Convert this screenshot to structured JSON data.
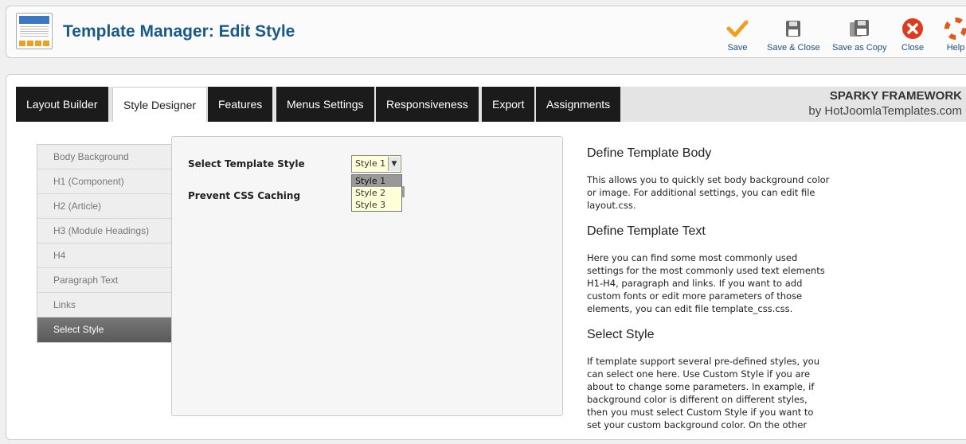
{
  "header": {
    "title": "Template Manager: Edit Style",
    "toolbar": [
      {
        "label": "Save",
        "icon": "checkmark-icon"
      },
      {
        "label": "Save & Close",
        "icon": "floppy-icon"
      },
      {
        "label": "Save as Copy",
        "icon": "floppy-copy-icon"
      },
      {
        "label": "Close",
        "icon": "close-circle-icon"
      },
      {
        "label": "Help",
        "icon": "lifebuoy-icon"
      }
    ]
  },
  "tabs": [
    "Layout Builder",
    "Style Designer",
    "Features",
    "Menus Settings",
    "Responsiveness",
    "Export",
    "Assignments"
  ],
  "active_tab": "Style Designer",
  "brand": {
    "title": "SPARKY FRAMEWORK",
    "subtitle": "by HotJoomlaTemplates.com"
  },
  "left_menu": [
    "Body Background",
    "H1 (Component)",
    "H2 (Article)",
    "H3 (Module Headings)",
    "H4",
    "Paragraph Text",
    "Links",
    "Select Style"
  ],
  "left_menu_active": "Select Style",
  "form": {
    "select_style_label": "Select Template Style",
    "prevent_caching_label": "Prevent CSS Caching",
    "select_value": "Style 1",
    "options": [
      "Style 1",
      "Style 2",
      "Style 3"
    ]
  },
  "descriptions": [
    {
      "heading": "Define Template Body",
      "text": "This allows you to quickly set body background color or image. For additional settings, you can edit file layout.css."
    },
    {
      "heading": "Define Template Text",
      "text": "Here you can find some most commonly used settings for the most commonly used text elements H1-H4, paragraph and links. If you want to add custom fonts or edit more parameters of those elements, you can edit file template_css.css."
    },
    {
      "heading": "Select Style",
      "text": "If template support several pre-defined styles, you can select one here. Use Custom Style if you are about to change some parameters. In example, if background color is different on different styles, then you must select Custom Style if you want to set your custom background color. On the other"
    }
  ],
  "colors": {
    "title": "#1a5a8a",
    "tab_bg": "#1b1b1b",
    "select_bg": "#ffffd8",
    "save_icon": "#f0a020",
    "close_icon": "#e03a1e"
  }
}
